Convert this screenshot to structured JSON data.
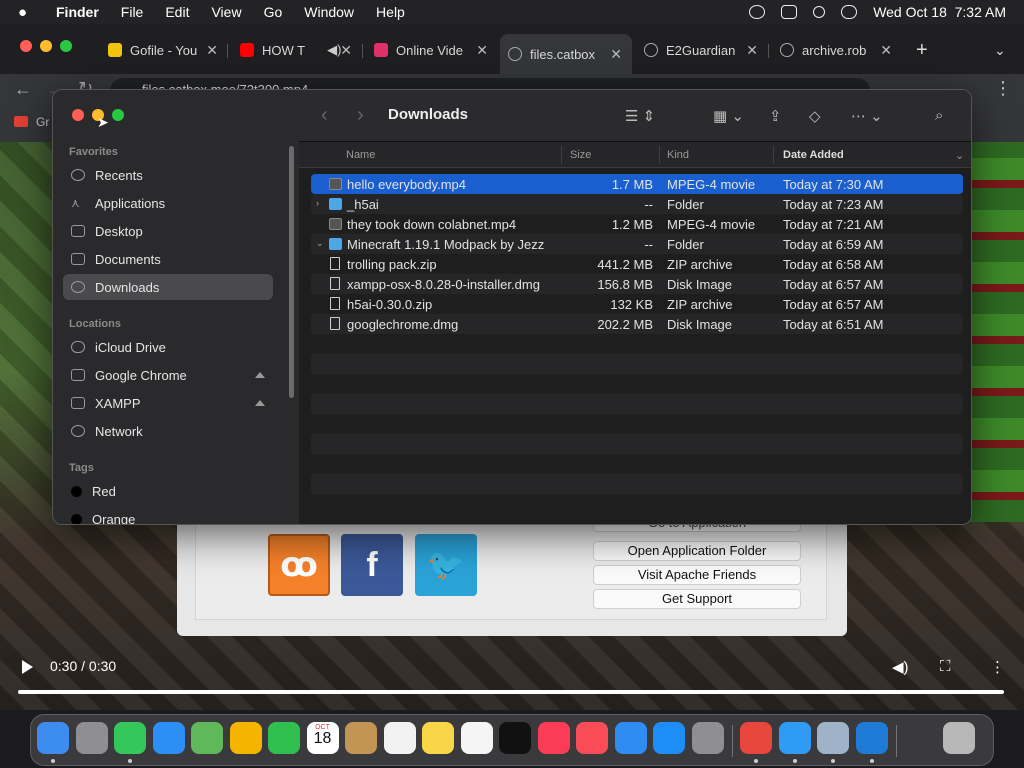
{
  "menubar": {
    "app": "Finder",
    "items": [
      "File",
      "Edit",
      "View",
      "Go",
      "Window",
      "Help"
    ],
    "datetime": "Wed Oct 18  7:32 AM"
  },
  "browser": {
    "tabs": [
      {
        "title": "Gofile - You",
        "favicon_color": "#f1c40f"
      },
      {
        "title": "HOW T",
        "favicon_color": "#ff0000"
      },
      {
        "title": "Online Vide",
        "favicon_color": "#e0316b"
      },
      {
        "title": "files.catbox",
        "favicon_color": "#9aa0a6"
      },
      {
        "title": "E2Guardian",
        "favicon_color": "#9aa0a6"
      },
      {
        "title": "archive.rob",
        "favicon_color": "#9aa0a6"
      }
    ],
    "url": "files.catbox.moe/72t300.mp4",
    "bookmark": "Gr"
  },
  "finder": {
    "title": "Downloads",
    "sidebar": {
      "favorites_label": "Favorites",
      "favorites": [
        "Recents",
        "Applications",
        "Desktop",
        "Documents",
        "Downloads"
      ],
      "locations_label": "Locations",
      "locations": [
        "iCloud Drive",
        "Google Chrome",
        "XAMPP",
        "Network"
      ],
      "tags_label": "Tags",
      "tags": [
        "Red",
        "Orange"
      ]
    },
    "columns": {
      "name": "Name",
      "size": "Size",
      "kind": "Kind",
      "date": "Date Added"
    },
    "files": [
      {
        "name": "hello everybody.mp4",
        "size": "1.7 MB",
        "kind": "MPEG-4 movie",
        "date": "Today at 7:30 AM",
        "type": "movie",
        "selected": true,
        "disclosure": ""
      },
      {
        "name": "_h5ai",
        "size": "--",
        "kind": "Folder",
        "date": "Today at 7:23 AM",
        "type": "folder",
        "selected": false,
        "disclosure": "›"
      },
      {
        "name": "they took down colabnet.mp4",
        "size": "1.2 MB",
        "kind": "MPEG-4 movie",
        "date": "Today at 7:21 AM",
        "type": "movie",
        "selected": false,
        "disclosure": ""
      },
      {
        "name": "Minecraft 1.19.1 Modpack by Jezz",
        "size": "--",
        "kind": "Folder",
        "date": "Today at 6:59 AM",
        "type": "folder",
        "selected": false,
        "disclosure": "⌄"
      },
      {
        "name": "trolling pack.zip",
        "size": "441.2 MB",
        "kind": "ZIP archive",
        "date": "Today at 6:58 AM",
        "type": "doc",
        "selected": false,
        "disclosure": ""
      },
      {
        "name": "xampp-osx-8.0.28-0-installer.dmg",
        "size": "156.8 MB",
        "kind": "Disk Image",
        "date": "Today at 6:57 AM",
        "type": "doc",
        "selected": false,
        "disclosure": ""
      },
      {
        "name": "h5ai-0.30.0.zip",
        "size": "132 KB",
        "kind": "ZIP archive",
        "date": "Today at 6:57 AM",
        "type": "doc",
        "selected": false,
        "disclosure": ""
      },
      {
        "name": "googlechrome.dmg",
        "size": "202.2 MB",
        "kind": "Disk Image",
        "date": "Today at 6:51 AM",
        "type": "doc",
        "selected": false,
        "disclosure": ""
      }
    ]
  },
  "xampp": {
    "buttons": [
      "Go to Application",
      "Open Application Folder",
      "Visit Apache Friends",
      "Get Support"
    ],
    "logos": [
      {
        "name": "xampp-logo",
        "glyph": "ꝏ",
        "color": "#f5812a"
      },
      {
        "name": "facebook-logo",
        "glyph": "f",
        "color": "#3b5998"
      },
      {
        "name": "twitter-logo",
        "glyph": "🐦",
        "color": "#2aa3d8"
      }
    ]
  },
  "video": {
    "time": "0:30 / 0:30",
    "progress": 1.0
  },
  "dock": {
    "apps": [
      {
        "name": "finder",
        "color": "#3d8cf0"
      },
      {
        "name": "launchpad",
        "color": "#8e8e93"
      },
      {
        "name": "messages",
        "color": "#34c759"
      },
      {
        "name": "mail",
        "color": "#2b8ff5"
      },
      {
        "name": "maps",
        "color": "#5fb85a"
      },
      {
        "name": "photos",
        "color": "#f4b400"
      },
      {
        "name": "facetime",
        "color": "#30c04f"
      },
      {
        "name": "calendar",
        "color": "#ffffff"
      },
      {
        "name": "contacts",
        "color": "#c29554"
      },
      {
        "name": "reminders",
        "color": "#f2f2f2"
      },
      {
        "name": "notes",
        "color": "#f9d648"
      },
      {
        "name": "freeform",
        "color": "#f5f5f5"
      },
      {
        "name": "tv",
        "color": "#111111"
      },
      {
        "name": "music",
        "color": "#fa3d55"
      },
      {
        "name": "news",
        "color": "#f94c57"
      },
      {
        "name": "keynote",
        "color": "#2e8cf3"
      },
      {
        "name": "app-store",
        "color": "#1c8ef6"
      },
      {
        "name": "system-settings",
        "color": "#8e8e93"
      },
      {
        "name": "google-chrome",
        "color": "#e8453c"
      },
      {
        "name": "safari",
        "color": "#2f9bf5"
      },
      {
        "name": "xampp-manager",
        "color": "#9fb3c8"
      },
      {
        "name": "vscode",
        "color": "#1f7ad6"
      },
      {
        "name": "screenshot-folder",
        "color": "#3a3a3c"
      },
      {
        "name": "trash",
        "color": "#b7b7b7"
      }
    ],
    "calendar": {
      "month": "OCT",
      "day": "18"
    }
  }
}
